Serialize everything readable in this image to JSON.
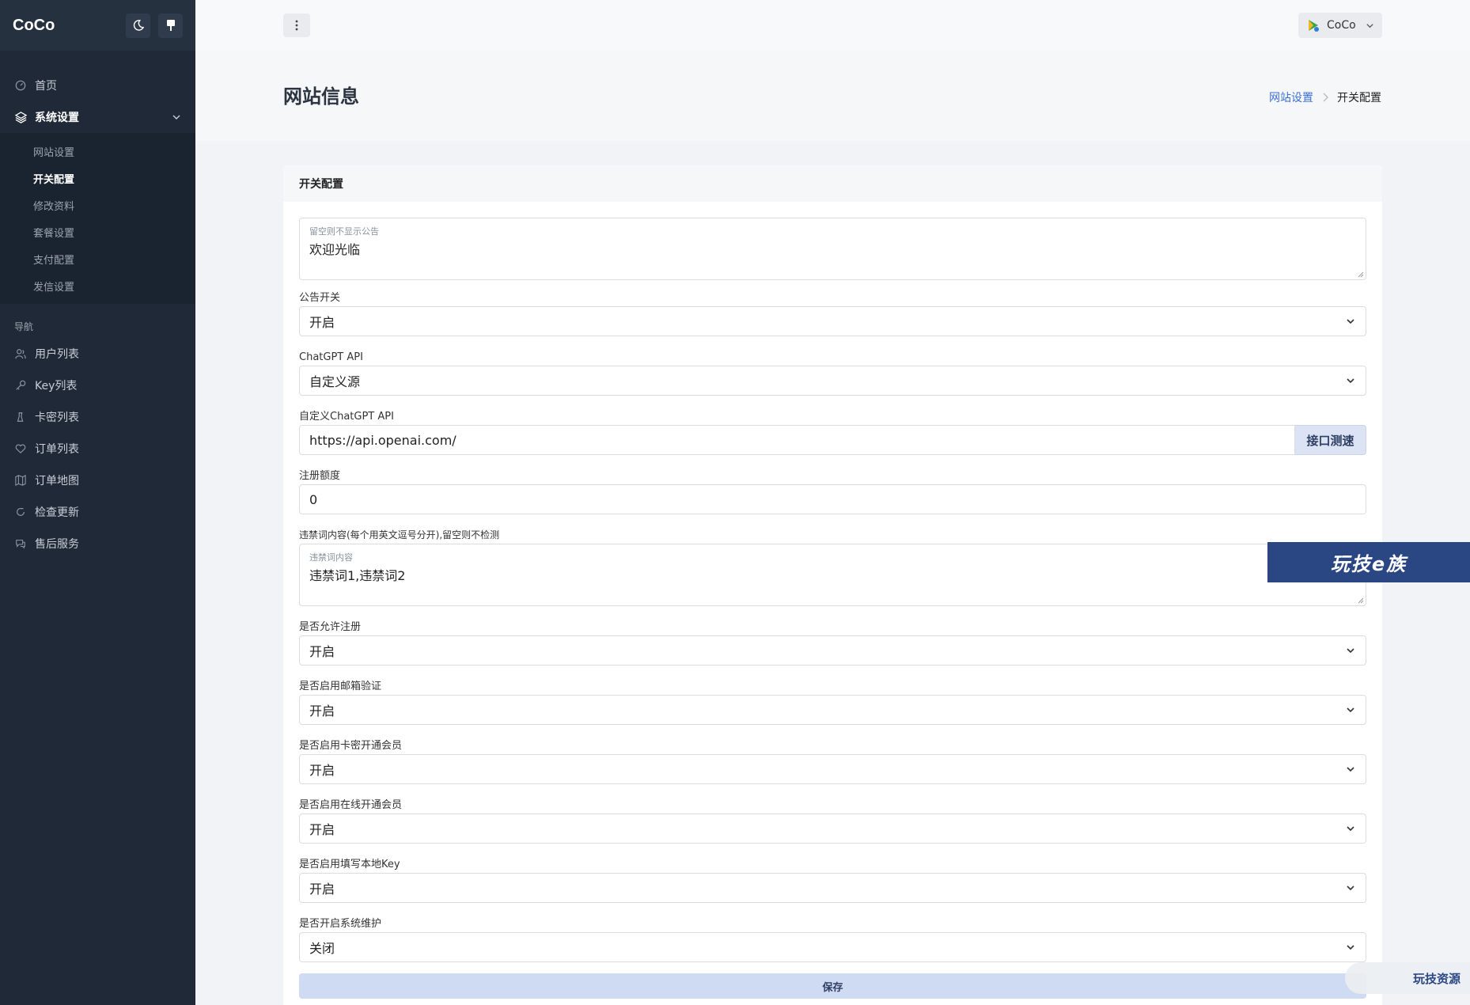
{
  "sidebar": {
    "brand": "CoCo",
    "menu": [
      {
        "label": "首页",
        "icon": "dashboard-icon"
      },
      {
        "label": "系统设置",
        "icon": "layers-icon"
      }
    ],
    "submenu": [
      "网站设置",
      "开关配置",
      "修改资料",
      "套餐设置",
      "支付配置",
      "发信设置"
    ],
    "section_heading": "导航",
    "nav": [
      {
        "label": "用户列表",
        "icon": "users-icon"
      },
      {
        "label": "Key列表",
        "icon": "key-icon"
      },
      {
        "label": "卡密列表",
        "icon": "chess-icon"
      },
      {
        "label": "订单列表",
        "icon": "heart-icon"
      },
      {
        "label": "订单地图",
        "icon": "map-icon"
      },
      {
        "label": "检查更新",
        "icon": "refresh-icon"
      },
      {
        "label": "售后服务",
        "icon": "chat-icon"
      }
    ]
  },
  "topbar": {
    "user_name": "CoCo"
  },
  "header": {
    "title": "网站信息",
    "breadcrumb": {
      "parent": "网站设置",
      "current": "开关配置"
    }
  },
  "card": {
    "title": "开关配置",
    "announcement": {
      "label": "留空则不显示公告",
      "value": "欢迎光临"
    },
    "notice_switch": {
      "label": "公告开关",
      "value": "开启"
    },
    "chatgpt_api": {
      "label": "ChatGPT API",
      "value": "自定义源"
    },
    "custom_api": {
      "label": "自定义ChatGPT API",
      "value": "https://api.openai.com/",
      "button": "接口测速"
    },
    "register_quota": {
      "label": "注册额度",
      "value": "0"
    },
    "banned_words": {
      "section_label": "违禁词内容(每个用英文逗号分开),留空则不检测",
      "label": "违禁词内容",
      "value": "违禁词1,违禁词2"
    },
    "allow_register": {
      "label": "是否允许注册",
      "value": "开启"
    },
    "email_verify": {
      "label": "是否启用邮箱验证",
      "value": "开启"
    },
    "card_member": {
      "label": "是否启用卡密开通会员",
      "value": "开启"
    },
    "online_member": {
      "label": "是否启用在线开通会员",
      "value": "开启"
    },
    "local_key": {
      "label": "是否启用填写本地Key",
      "value": "开启"
    },
    "maintenance": {
      "label": "是否开启系统维护",
      "value": "关闭"
    },
    "save": "保存"
  },
  "watermarks": {
    "banner": "玩技e族",
    "chip": "玩技资源"
  }
}
